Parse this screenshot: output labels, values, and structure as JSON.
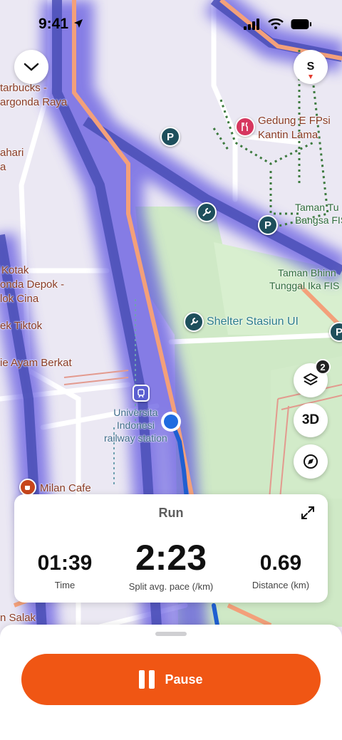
{
  "status_bar": {
    "time": "9:41"
  },
  "map": {
    "labels": {
      "starbucks": "tarbucks -",
      "margonda_raya": "argonda Raya",
      "ahari": "ahari",
      "a": "a",
      "gedung": "Gedung E FPsi",
      "kantin": "Kantin Lama",
      "taman_tu": "Taman Tu",
      "bangsa": "Bangsa FIS",
      "kotak": "Kotak",
      "margonda_depok": "onda Depok -",
      "lok_cina": "lok Cina",
      "taman_bhinn": "Taman Bhinn",
      "tunggal": "Tunggal Ika FIS",
      "tiktok": "ek Tiktok",
      "shelter": "Shelter Stasiun UI",
      "ayam": "ie Ayam Berkat",
      "station": "Universita\nIndonesi\nrailway station",
      "milan": "Milan Cafe",
      "salak": "n Salak"
    }
  },
  "controls": {
    "compass_letter": "S",
    "layers_badge": "2",
    "three_d_label": "3D"
  },
  "stats_card": {
    "title": "Run",
    "time": {
      "value": "01:39",
      "label": "Time"
    },
    "pace": {
      "value": "2:23",
      "label": "Split avg. pace (/km)"
    },
    "distance": {
      "value": "0.69",
      "label": "Distance (km)"
    }
  },
  "bottom": {
    "pause_label": "Pause"
  },
  "colors": {
    "accent": "#f05614",
    "route": "#1f5fd1",
    "road_glow": "#4a4fd8"
  }
}
